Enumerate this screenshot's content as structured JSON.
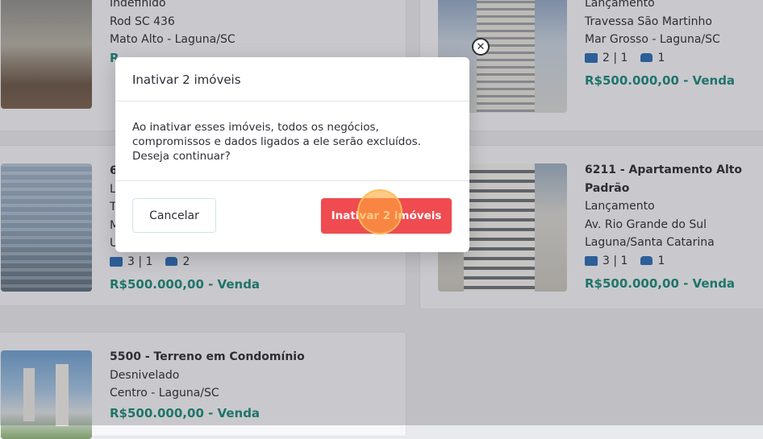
{
  "listings": {
    "card1": {
      "line1": "Indefinido",
      "line2": "Rod SC 436",
      "line3": "Mato Alto - Laguna/SC",
      "price_fragment": "R"
    },
    "card2": {
      "line1": "Lançamento",
      "line2": "Travessa São Martinho",
      "line3": "Mar Grosso - Laguna/SC",
      "beds": "2 | 1",
      "cars": "1",
      "price": "R$500.000,00 - Venda"
    },
    "card3": {
      "frag1": "6",
      "frag2": "L",
      "frag3": "T",
      "frag4": "M",
      "frag5": "U",
      "beds": "3 | 1",
      "cars": "2",
      "price": "R$500.000,00 - Venda"
    },
    "card4": {
      "title": "6211 - Apartamento Alto Padrão",
      "line1": "Lançamento",
      "line2": "Av. Rio Grande do Sul",
      "line3": "Laguna/Santa Catarina",
      "beds": "3 | 1",
      "cars": "1",
      "price": "R$500.000,00 - Venda"
    },
    "card5": {
      "title": "5500 - Terreno em Condomínio",
      "line1": "Desnivelado",
      "line2": "Centro - Laguna/SC",
      "price": "R$500.000,00 - Venda"
    }
  },
  "dialog": {
    "title": "Inativar 2 imóveis",
    "message_lines": [
      "Ao inativar esses imóveis, todos os negócios,",
      "compromissos e dados ligados a ele serão excluídos.",
      "Deseja continuar?"
    ],
    "cancel_label": "Cancelar",
    "confirm_label": "Inativar 2 imóveis",
    "close_symbol": "✕"
  },
  "icons": {
    "bed": "bed-icon",
    "car": "car-icon",
    "close": "close-icon"
  },
  "colors": {
    "confirm": "#ef4b50",
    "price": "#1e8a7a",
    "feature_icon": "#2f6db5"
  }
}
